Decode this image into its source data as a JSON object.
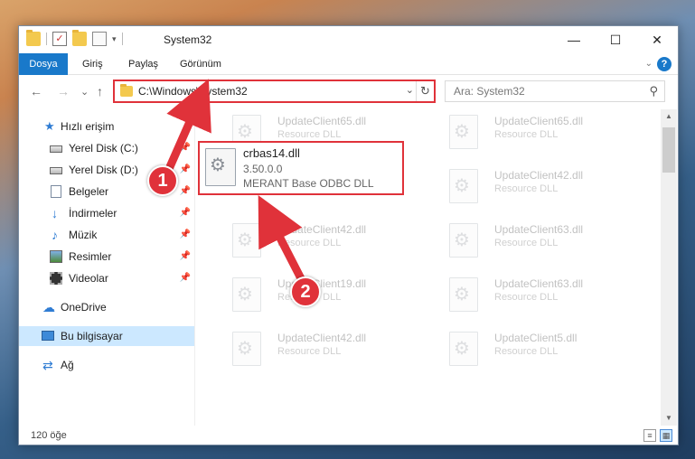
{
  "window": {
    "title": "System32",
    "minimize_glyph": "—",
    "maximize_glyph": "☐",
    "close_glyph": "✕"
  },
  "ribbon": {
    "tabs": [
      "Dosya",
      "Giriş",
      "Paylaş",
      "Görünüm"
    ],
    "collapse_glyph": "⌄",
    "help_glyph": "?"
  },
  "nav": {
    "back_glyph": "←",
    "forward_glyph": "→",
    "recent_glyph": "⌄",
    "up_glyph": "↑",
    "address_path": "C:\\Windows\\System32",
    "address_dropdown_glyph": "⌄",
    "refresh_glyph": "↻",
    "search_placeholder": "Ara: System32",
    "search_glyph": "⚲"
  },
  "sidebar": {
    "items": [
      {
        "label": "Hızlı erişim",
        "icon": "star-icon",
        "glyph": "★"
      },
      {
        "label": "Yerel Disk (C:)",
        "icon": "drive-icon",
        "glyph": "",
        "pinned": true
      },
      {
        "label": "Yerel Disk (D:)",
        "icon": "drive-icon",
        "glyph": "",
        "pinned": true
      },
      {
        "label": "Belgeler",
        "icon": "documents-icon",
        "glyph": "",
        "pinned": true
      },
      {
        "label": "İndirmeler",
        "icon": "downloads-icon",
        "glyph": "↓",
        "pinned": true
      },
      {
        "label": "Müzik",
        "icon": "music-icon",
        "glyph": "♪",
        "pinned": true
      },
      {
        "label": "Resimler",
        "icon": "pictures-icon",
        "glyph": "",
        "pinned": true
      },
      {
        "label": "Videolar",
        "icon": "videos-icon",
        "glyph": "",
        "pinned": true
      },
      {
        "label": "OneDrive",
        "icon": "onedrive-icon",
        "glyph": "☁"
      },
      {
        "label": "Bu bilgisayar",
        "icon": "this-pc-icon",
        "glyph": "",
        "selected": true
      },
      {
        "label": "Ağ",
        "icon": "network-icon",
        "glyph": "⇄"
      }
    ],
    "pin_glyph": "📌"
  },
  "files": [
    {
      "name": "UpdateClient65.dll",
      "desc": "Resource DLL"
    },
    {
      "name": "UpdateClient65.dll",
      "desc": "Resource DLL"
    },
    {
      "name": "UpdateClient42.dll",
      "desc": "Resource DLL"
    },
    {
      "name": "UpdateClient42.dll",
      "desc": "Resource DLL"
    },
    {
      "name": "UpdateClient63.dll",
      "desc": "Resource DLL"
    },
    {
      "name": "UpdateClient19.dll",
      "desc": "Resource DLL"
    },
    {
      "name": "UpdateClient63.dll",
      "desc": "Resource DLL"
    },
    {
      "name": "UpdateClient42.dll",
      "desc": "Resource DLL"
    },
    {
      "name": "UpdateClient5.dll",
      "desc": "Resource DLL"
    }
  ],
  "highlighted_file": {
    "name": "crbas14.dll",
    "version": "3.50.0.0",
    "desc": "MERANT Base ODBC DLL"
  },
  "status": {
    "item_count": "120 öğe"
  },
  "annotations": {
    "step1": "1",
    "step2": "2",
    "color": "#e0323a"
  }
}
